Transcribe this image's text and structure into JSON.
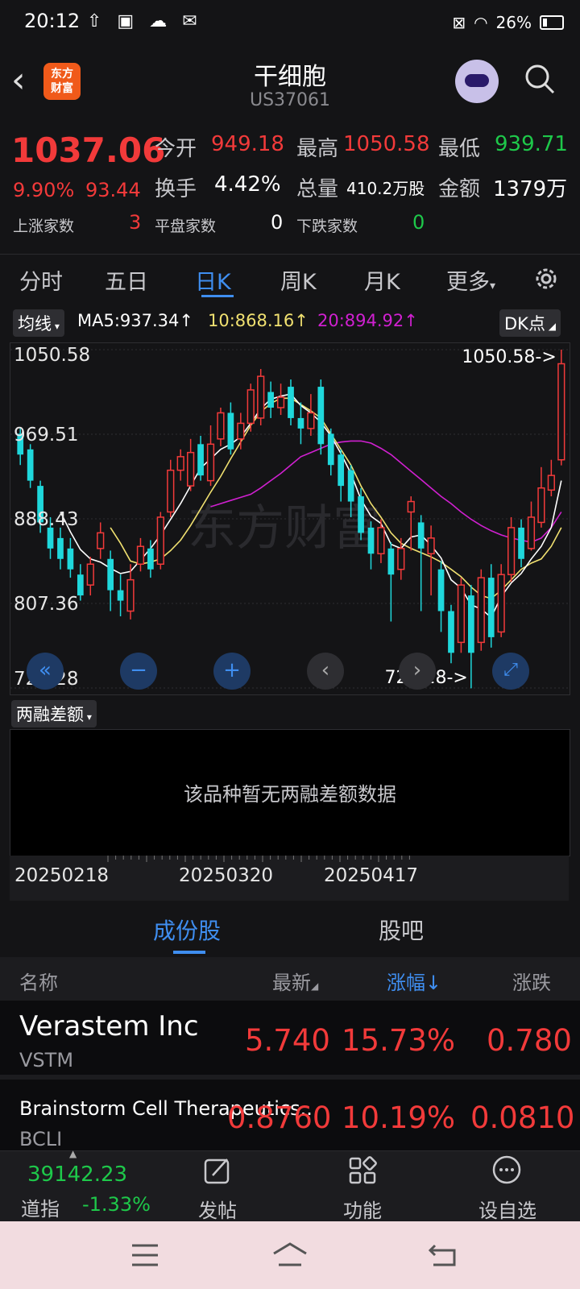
{
  "status": {
    "time": "20:12",
    "battery": "26%"
  },
  "header": {
    "title": "干细胞",
    "subtitle": "US37061",
    "logo_text": "东方财富"
  },
  "quote": {
    "price": "1037.06",
    "change_pct": "9.90%",
    "change": "93.44",
    "open_label": "今开",
    "open": "949.18",
    "high_label": "最高",
    "high": "1050.58",
    "low_label": "最低",
    "low": "939.71",
    "turnover_label": "换手",
    "turnover": "4.42%",
    "volume_label": "总量",
    "volume": "410.2万股",
    "amount_label": "金额",
    "amount": "1379万",
    "up_label": "上涨家数",
    "up": "3",
    "flat_label": "平盘家数",
    "flat": "0",
    "down_label": "下跌家数",
    "down": "0"
  },
  "tabs": [
    "分时",
    "五日",
    "日K",
    "周K",
    "月K",
    "更多"
  ],
  "active_tab": "日K",
  "chart_toolbar": {
    "ma_selector": "均线",
    "ma5": "MA5:937.34↑",
    "ma10": "10:868.16↑",
    "ma20": "20:894.92↑",
    "dk": "DK点"
  },
  "colors": {
    "up": "#f23a3a",
    "down": "#1fd8dc",
    "ma5": "#ffffff",
    "ma10": "#f0e070",
    "ma20": "#d020d0",
    "accent": "#3f8ef0"
  },
  "chart_data": {
    "type": "candlestick",
    "ylim": [
      726.28,
      1050.58
    ],
    "y_ticks": [
      "1050.58",
      "969.51",
      "888.43",
      "807.36",
      "726.28"
    ],
    "max_label": "1050.58->",
    "min_label": "726.28->",
    "watermark": "东方财富",
    "candles": [
      {
        "o": 970,
        "c": 950,
        "h": 975,
        "l": 940
      },
      {
        "o": 955,
        "c": 925,
        "h": 960,
        "l": 918
      },
      {
        "o": 920,
        "c": 885,
        "h": 925,
        "l": 875
      },
      {
        "o": 880,
        "c": 860,
        "h": 890,
        "l": 850
      },
      {
        "o": 870,
        "c": 850,
        "h": 880,
        "l": 840
      },
      {
        "o": 860,
        "c": 840,
        "h": 870,
        "l": 832
      },
      {
        "o": 835,
        "c": 815,
        "h": 845,
        "l": 810
      },
      {
        "o": 825,
        "c": 845,
        "h": 852,
        "l": 815
      },
      {
        "o": 860,
        "c": 875,
        "h": 885,
        "l": 850
      },
      {
        "o": 850,
        "c": 820,
        "h": 858,
        "l": 800
      },
      {
        "o": 820,
        "c": 810,
        "h": 835,
        "l": 795
      },
      {
        "o": 800,
        "c": 830,
        "h": 845,
        "l": 792
      },
      {
        "o": 845,
        "c": 862,
        "h": 870,
        "l": 838
      },
      {
        "o": 860,
        "c": 840,
        "h": 868,
        "l": 832
      },
      {
        "o": 845,
        "c": 890,
        "h": 895,
        "l": 840
      },
      {
        "o": 895,
        "c": 935,
        "h": 945,
        "l": 890
      },
      {
        "o": 935,
        "c": 948,
        "h": 955,
        "l": 925
      },
      {
        "o": 920,
        "c": 952,
        "h": 965,
        "l": 915
      },
      {
        "o": 960,
        "c": 930,
        "h": 968,
        "l": 925
      },
      {
        "o": 925,
        "c": 960,
        "h": 978,
        "l": 920
      },
      {
        "o": 965,
        "c": 990,
        "h": 995,
        "l": 958
      },
      {
        "o": 990,
        "c": 955,
        "h": 1000,
        "l": 950
      },
      {
        "o": 965,
        "c": 980,
        "h": 990,
        "l": 955
      },
      {
        "o": 980,
        "c": 1012,
        "h": 1018,
        "l": 972
      },
      {
        "o": 985,
        "c": 1025,
        "h": 1032,
        "l": 978
      },
      {
        "o": 1010,
        "c": 995,
        "h": 1020,
        "l": 985
      },
      {
        "o": 995,
        "c": 1005,
        "h": 1018,
        "l": 988
      },
      {
        "o": 1015,
        "c": 985,
        "h": 1022,
        "l": 978
      },
      {
        "o": 985,
        "c": 975,
        "h": 1000,
        "l": 960
      },
      {
        "o": 975,
        "c": 990,
        "h": 1008,
        "l": 968
      },
      {
        "o": 1015,
        "c": 960,
        "h": 1022,
        "l": 950
      },
      {
        "o": 970,
        "c": 940,
        "h": 975,
        "l": 930
      },
      {
        "o": 950,
        "c": 920,
        "h": 955,
        "l": 905
      },
      {
        "o": 935,
        "c": 905,
        "h": 940,
        "l": 890
      },
      {
        "o": 910,
        "c": 875,
        "h": 918,
        "l": 868
      },
      {
        "o": 880,
        "c": 855,
        "h": 886,
        "l": 840
      },
      {
        "o": 855,
        "c": 880,
        "h": 888,
        "l": 846
      },
      {
        "o": 860,
        "c": 835,
        "h": 866,
        "l": 790
      },
      {
        "o": 840,
        "c": 860,
        "h": 870,
        "l": 830
      },
      {
        "o": 895,
        "c": 905,
        "h": 910,
        "l": 858
      },
      {
        "o": 885,
        "c": 860,
        "h": 892,
        "l": 800
      },
      {
        "o": 855,
        "c": 870,
        "h": 882,
        "l": 815
      },
      {
        "o": 840,
        "c": 800,
        "h": 848,
        "l": 780
      },
      {
        "o": 800,
        "c": 760,
        "h": 806,
        "l": 750
      },
      {
        "o": 770,
        "c": 825,
        "h": 832,
        "l": 760
      },
      {
        "o": 815,
        "c": 760,
        "h": 825,
        "l": 726
      },
      {
        "o": 770,
        "c": 832,
        "h": 840,
        "l": 762
      },
      {
        "o": 832,
        "c": 775,
        "h": 845,
        "l": 765
      },
      {
        "o": 780,
        "c": 835,
        "h": 845,
        "l": 775
      },
      {
        "o": 835,
        "c": 880,
        "h": 890,
        "l": 828
      },
      {
        "o": 880,
        "c": 850,
        "h": 888,
        "l": 842
      },
      {
        "o": 860,
        "c": 890,
        "h": 905,
        "l": 858
      },
      {
        "o": 885,
        "c": 918,
        "h": 938,
        "l": 880
      },
      {
        "o": 916,
        "c": 930,
        "h": 945,
        "l": 910
      },
      {
        "o": 945,
        "c": 1037.06,
        "h": 1050.58,
        "l": 939.71
      }
    ],
    "ma5": [
      null,
      null,
      null,
      null,
      895,
      876,
      859,
      850,
      847,
      841,
      836,
      838,
      849,
      860,
      873,
      888,
      903,
      920,
      937,
      946,
      955,
      960,
      967,
      980,
      994,
      1003,
      1006,
      1008,
      997,
      990,
      981,
      968,
      951,
      932,
      907,
      891,
      884,
      864,
      860,
      871,
      873,
      863,
      851,
      830,
      822,
      806,
      802,
      794,
      814,
      827,
      836,
      850,
      862,
      880,
      925
    ],
    "ma10": [
      null,
      null,
      null,
      null,
      null,
      null,
      null,
      null,
      null,
      880,
      865,
      848,
      845,
      847,
      850,
      858,
      868,
      882,
      898,
      914,
      929,
      946,
      962,
      978,
      991,
      999,
      1004,
      1004,
      998,
      992,
      985,
      970,
      955,
      940,
      920,
      903,
      890,
      875,
      865,
      860,
      856,
      852,
      847,
      840,
      833,
      823,
      815,
      812,
      820,
      830,
      840,
      846,
      850,
      862,
      880
    ],
    "ma20": [
      null,
      null,
      null,
      null,
      null,
      null,
      null,
      null,
      null,
      null,
      null,
      null,
      null,
      null,
      null,
      null,
      null,
      null,
      null,
      900,
      903,
      906,
      909,
      912,
      918,
      925,
      932,
      940,
      948,
      952,
      956,
      960,
      962,
      963,
      963,
      961,
      956,
      950,
      942,
      934,
      926,
      918,
      910,
      903,
      895,
      888,
      882,
      877,
      873,
      870,
      868,
      866,
      870,
      880,
      895
    ]
  },
  "chart_controls": [
    "fast-back",
    "zoom-out",
    "zoom-in",
    "prev",
    "next",
    "fullscreen"
  ],
  "margin": {
    "selector": "两融差额",
    "empty_text": "该品种暂无两融差额数据"
  },
  "date_axis": [
    "20250218",
    "20250320",
    "20250417"
  ],
  "section_tabs": [
    "成份股",
    "股吧"
  ],
  "table": {
    "headers": {
      "name": "名称",
      "latest": "最新",
      "change_pct": "涨幅↓",
      "change": "涨跌"
    },
    "rows": [
      {
        "name": "Verastem Inc",
        "code": "VSTM",
        "latest": "5.740",
        "pct": "15.73%",
        "chg": "0.780"
      },
      {
        "name": "Brainstorm Cell Therapeutics..",
        "code": "BCLI",
        "latest": "0.8760",
        "pct": "10.19%",
        "chg": "0.0810"
      }
    ]
  },
  "bottom_bar": {
    "index_value": "39142.23",
    "index_name": "道指",
    "index_change": "-1.33%",
    "post": "发帖",
    "features": "功能",
    "watchlist": "设自选"
  }
}
